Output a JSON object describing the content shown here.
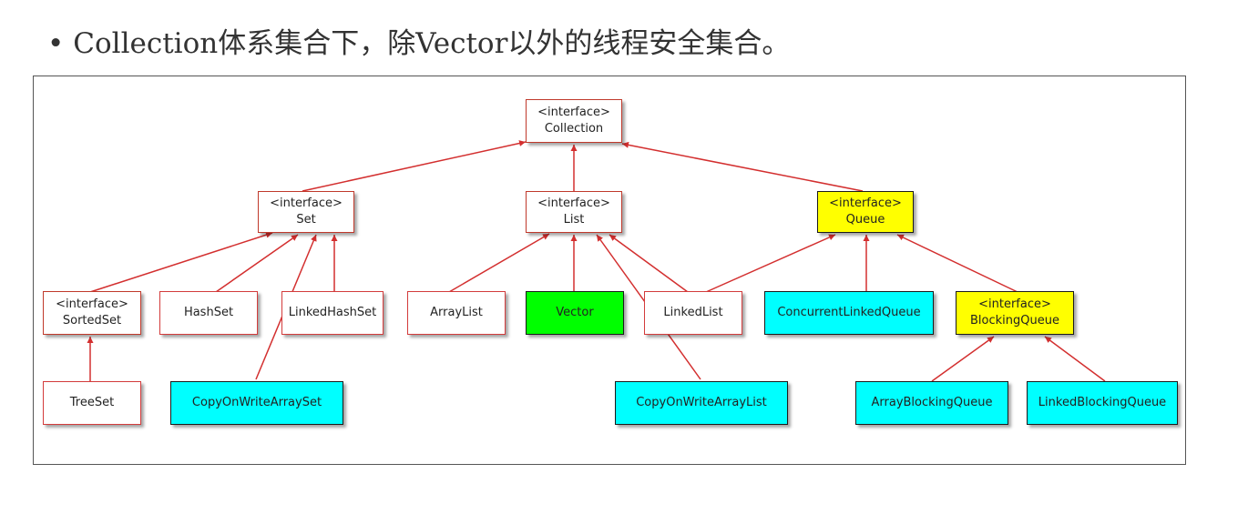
{
  "heading": {
    "bullet": "•",
    "text": "Collection体系集合下，除Vector以外的线程安全集合。"
  },
  "colors": {
    "edge": "#d32f2f",
    "thread_safe": "#00ffff",
    "vector": "#00ff00",
    "queue_interface": "#ffff00"
  },
  "nodes": {
    "collection": {
      "stereotype": "<interface>",
      "name": "Collection"
    },
    "set": {
      "stereotype": "<interface>",
      "name": "Set"
    },
    "list": {
      "stereotype": "<interface>",
      "name": "List"
    },
    "queue": {
      "stereotype": "<interface>",
      "name": "Queue"
    },
    "sortedset": {
      "stereotype": "<interface>",
      "name": "SortedSet"
    },
    "hashset": {
      "name": "HashSet"
    },
    "linkedhashset": {
      "name": "LinkedHashSet"
    },
    "arraylist": {
      "name": "ArrayList"
    },
    "vector": {
      "name": "Vector"
    },
    "linkedlist": {
      "name": "LinkedList"
    },
    "concurrentlinkedqueue": {
      "name": "ConcurrentLinkedQueue"
    },
    "blockingqueue": {
      "stereotype": "<interface>",
      "name": "BlockingQueue"
    },
    "treeset": {
      "name": "TreeSet"
    },
    "copyonwritearrayset": {
      "name": "CopyOnWriteArraySet"
    },
    "copyonwritearraylist": {
      "name": "CopyOnWriteArrayList"
    },
    "arrayblockingqueue": {
      "name": "ArrayBlockingQueue"
    },
    "linkedblockingqueue": {
      "name": "LinkedBlockingQueue"
    }
  }
}
